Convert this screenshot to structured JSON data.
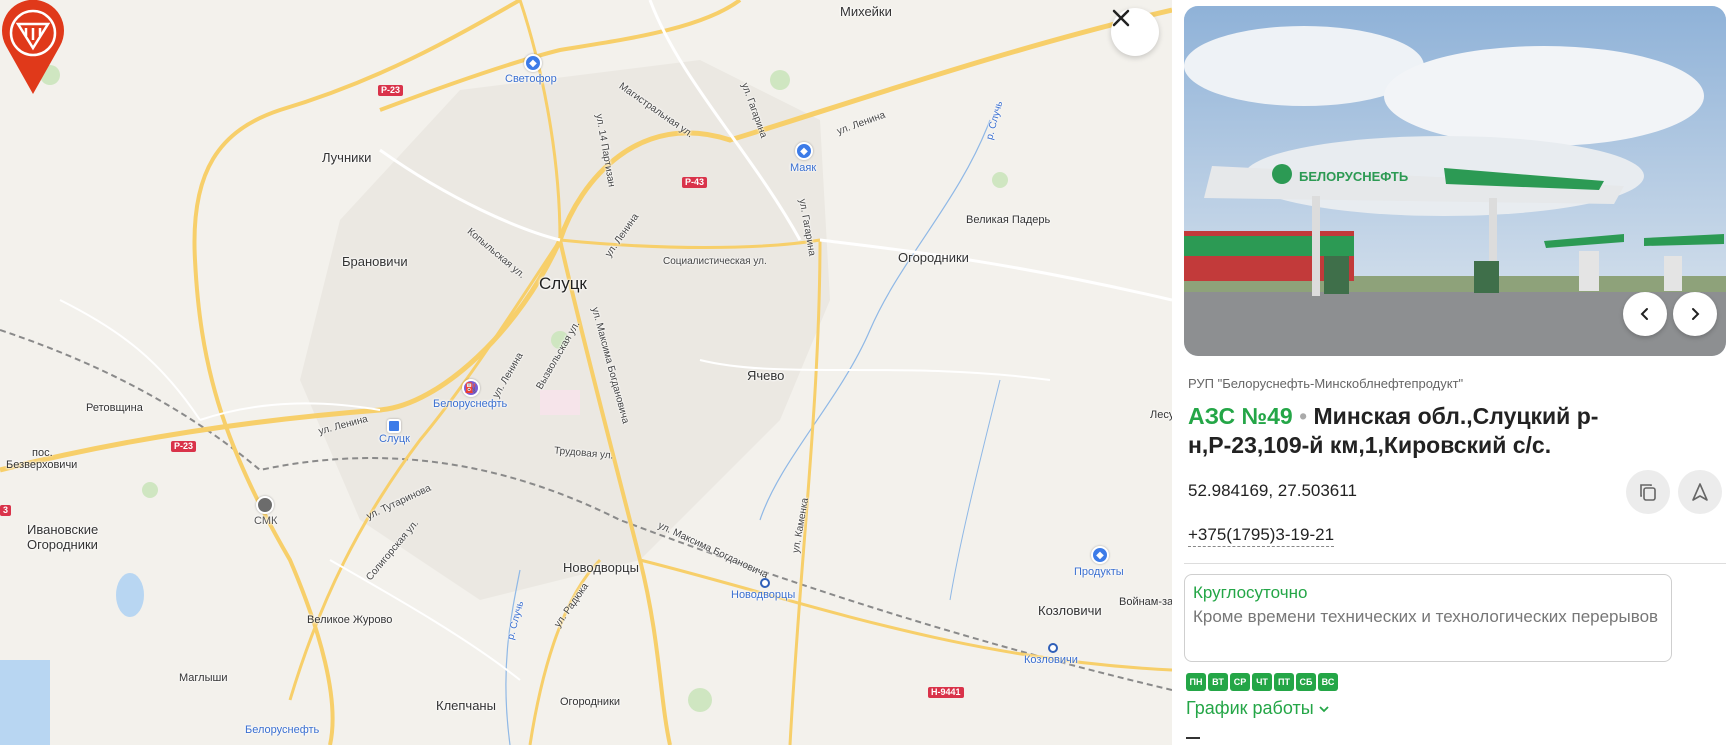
{
  "map": {
    "city": "Слуцк",
    "towns": [
      "Михейки",
      "Лучники",
      "Брановичи",
      "Ретовщина",
      "пос.",
      "Безверховичи",
      "Ивановские",
      "Огородники",
      "Великое Журово",
      "Маглыши",
      "Клепчаны",
      "Огородники",
      "Новодворцы",
      "Ячево",
      "Огородники",
      "Великая Падерь",
      "Козловичи",
      "Войнам-за",
      "Лесу"
    ],
    "streets": [
      "Магистральная ул.",
      "ул. 14 Партизан",
      "ул. Гагарина",
      "ул. Ленина",
      "ул. Гагарина",
      "Копыльская ул.",
      "ул. Ленина",
      "Социалистическая ул.",
      "ул. Максима Богдановича",
      "ул. Ленина",
      "Вызвольская ул.",
      "ул. Ленина",
      "Трудовая ул.",
      "ул. Тутаринова",
      "Солигорская ул.",
      "ул. Максима Богдановича",
      "ул. Каменка",
      "ул. Радюка",
      "р. Случь",
      "р. Случь"
    ],
    "roads": [
      "Р-23",
      "Р-43",
      "Р-23",
      "Н-9441",
      "3"
    ],
    "pois": [
      "Светофор",
      "Маяк",
      "Белоруснефть",
      "Слуцк",
      "СМК",
      "Продукты",
      "Белоруснефть"
    ],
    "stations": [
      "Новодворцы",
      "Козловичи"
    ]
  },
  "close_icon": "close-icon",
  "station": {
    "company": "РУП \"Белоруснефть-Минскоблнефтепродукт\"",
    "name": "АЗС №49",
    "separator": "•",
    "address": "Минская обл.,Слуцкий р-н,Р-23,109-й км,1,Кировский с/с.",
    "coordinates": "52.984169, 27.503611",
    "phone": "+375(1795)3-19-21",
    "hours_title": "Круглосуточно",
    "hours_note": "Кроме времени технических и технологических перерывов",
    "days": [
      "ПН",
      "ВТ",
      "СР",
      "ЧТ",
      "ПТ",
      "СБ",
      "ВС"
    ],
    "schedule_label": "График работы",
    "photo_brand": "БЕЛОРУСНЕФТЬ"
  },
  "colors": {
    "accent": "#24a647",
    "pin": "#e0391a",
    "road": "#f7cf6a"
  }
}
